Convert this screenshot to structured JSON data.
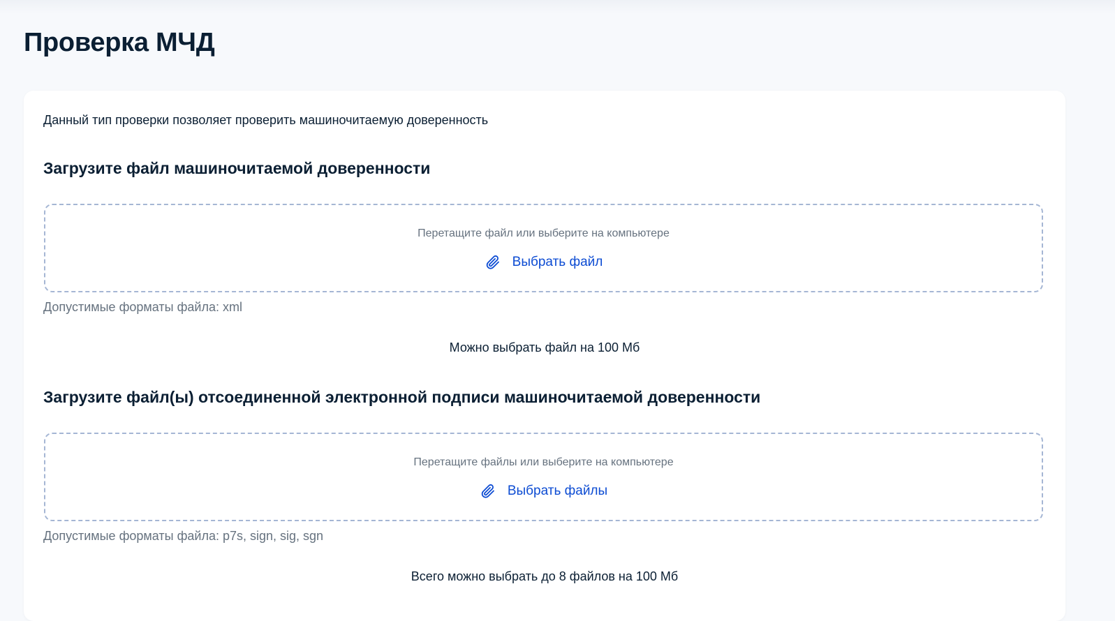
{
  "page": {
    "title": "Проверка МЧД"
  },
  "card": {
    "intro": "Данный тип проверки позволяет проверить машиночитаемую доверенность"
  },
  "sections": [
    {
      "title": "Загрузите файл машиночитаемой доверенности",
      "dropzone_hint": "Перетащите файл или выберите на компьютере",
      "button_label": "Выбрать файл",
      "button_icon": "paperclip-icon",
      "formats": "Допустимые форматы файла: xml",
      "limit": "Можно выбрать файл на 100 Мб"
    },
    {
      "title": "Загрузите файл(ы) отсоединенной электронной подписи машиночитаемой доверенности",
      "dropzone_hint": "Перетащите файлы или выберите на компьютере",
      "button_label": "Выбрать файлы",
      "button_icon": "paperclip-icon",
      "formats": "Допустимые форматы файла: p7s, sign, sig, sgn",
      "limit": "Всего можно выбрать до 8 файлов на 100 Мб"
    }
  ],
  "colors": {
    "accent": "#0d4cd3",
    "text": "#0b1f33",
    "muted": "#66727f",
    "dropzone_border": "#a5b6d4",
    "background": "#f7f9fc"
  }
}
